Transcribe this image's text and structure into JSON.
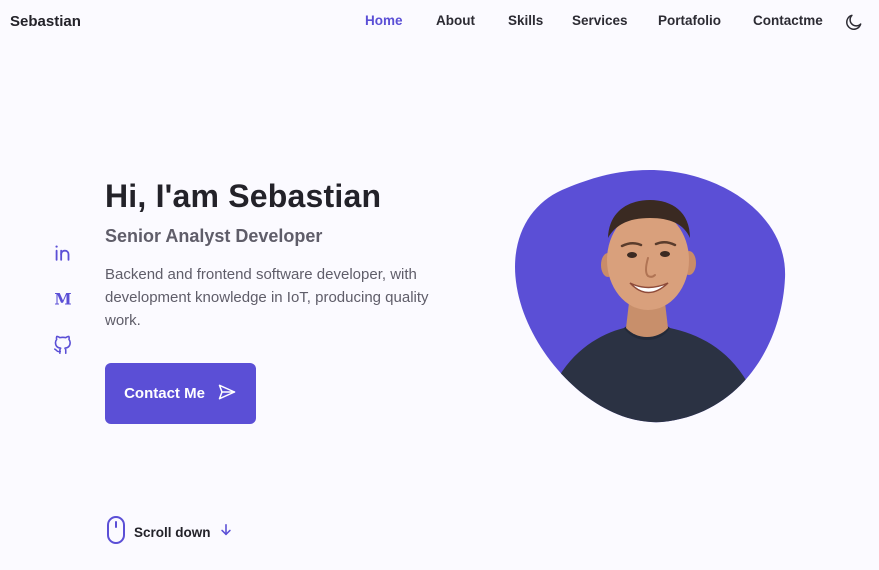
{
  "header": {
    "logo": "Sebastian",
    "nav": [
      {
        "label": "Home",
        "active": true
      },
      {
        "label": "About",
        "active": false
      },
      {
        "label": "Skills",
        "active": false
      },
      {
        "label": "Services",
        "active": false
      },
      {
        "label": "Portafolio",
        "active": false
      },
      {
        "label": "Contactme",
        "active": false
      }
    ],
    "theme_icon": "moon-icon"
  },
  "socials": [
    {
      "icon": "linkedin-icon"
    },
    {
      "icon": "medium-icon"
    },
    {
      "icon": "github-icon"
    }
  ],
  "hero": {
    "title": "Hi, I'am Sebastian",
    "subtitle": "Senior Analyst Developer",
    "description": "Backend and frontend software developer, with development knowledge in IoT, producing quality work.",
    "button_label": "Contact Me",
    "button_icon": "send-icon"
  },
  "scroll": {
    "label": "Scroll down",
    "icon": "mouse-icon",
    "arrow_icon": "arrow-down-icon"
  },
  "colors": {
    "accent": "#5b4fd6",
    "background": "#fbfaff",
    "title": "#232229",
    "text": "#5f5d69"
  }
}
